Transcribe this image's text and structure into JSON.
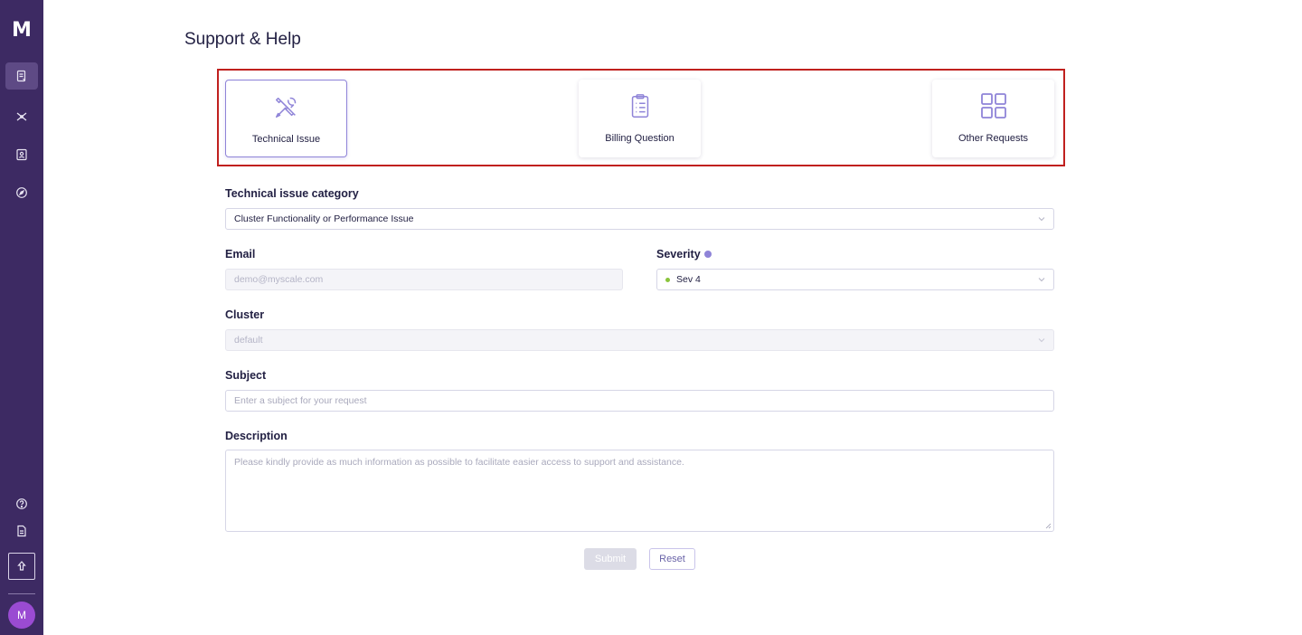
{
  "sidebar": {
    "logo": "M",
    "avatar_initial": "M"
  },
  "page": {
    "title": "Support & Help"
  },
  "request_types": [
    {
      "label": "Technical Issue",
      "icon": "tools-icon",
      "selected": true
    },
    {
      "label": "Billing Question",
      "icon": "clipboard-icon",
      "selected": false
    },
    {
      "label": "Other Requests",
      "icon": "grid-icon",
      "selected": false
    }
  ],
  "form": {
    "category_label": "Technical issue category",
    "category_value": "Cluster Functionality or Performance Issue",
    "email_label": "Email",
    "email_placeholder": "demo@myscale.com",
    "severity_label": "Severity",
    "severity_value": "Sev 4",
    "cluster_label": "Cluster",
    "cluster_value": "default",
    "subject_label": "Subject",
    "subject_placeholder": "Enter a subject for your request",
    "description_label": "Description",
    "description_placeholder": "Please kindly provide as much information as possible to facilitate easier access to support and assistance.",
    "submit_label": "Submit",
    "reset_label": "Reset"
  },
  "colors": {
    "sidebar_bg": "#3d2a63",
    "accent": "#8f84d8",
    "highlight": "#c0201e",
    "severity_dot": "#8ac43c",
    "avatar": "#9a4bd2"
  }
}
